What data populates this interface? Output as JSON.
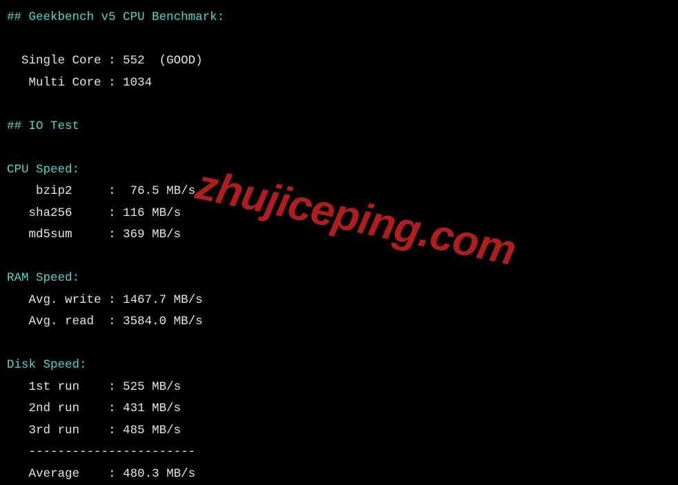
{
  "geekbench": {
    "header": "## Geekbench v5 CPU Benchmark:",
    "single_core_label": "  Single Core : ",
    "single_core_value": "552  (GOOD)",
    "multi_core_label": "   Multi Core : ",
    "multi_core_value": "1034"
  },
  "io_test_header": "## IO Test",
  "cpu_speed": {
    "header": "CPU Speed:",
    "bzip2_label": "    bzip2     :  ",
    "bzip2_value": "76.5 MB/s",
    "sha256_label": "   sha256     : ",
    "sha256_value": "116 MB/s",
    "md5sum_label": "   md5sum     : ",
    "md5sum_value": "369 MB/s"
  },
  "ram_speed": {
    "header": "RAM Speed:",
    "write_label": "   Avg. write : ",
    "write_value": "1467.7 MB/s",
    "read_label": "   Avg. read  : ",
    "read_value": "3584.0 MB/s"
  },
  "disk_speed": {
    "header": "Disk Speed:",
    "run1_label": "   1st run    : ",
    "run1_value": "525 MB/s",
    "run2_label": "   2nd run    : ",
    "run2_value": "431 MB/s",
    "run3_label": "   3rd run    : ",
    "run3_value": "485 MB/s",
    "divider": "   -----------------------",
    "avg_label": "   Average    : ",
    "avg_value": "480.3 MB/s"
  },
  "watermark": "zhujiceping.com"
}
